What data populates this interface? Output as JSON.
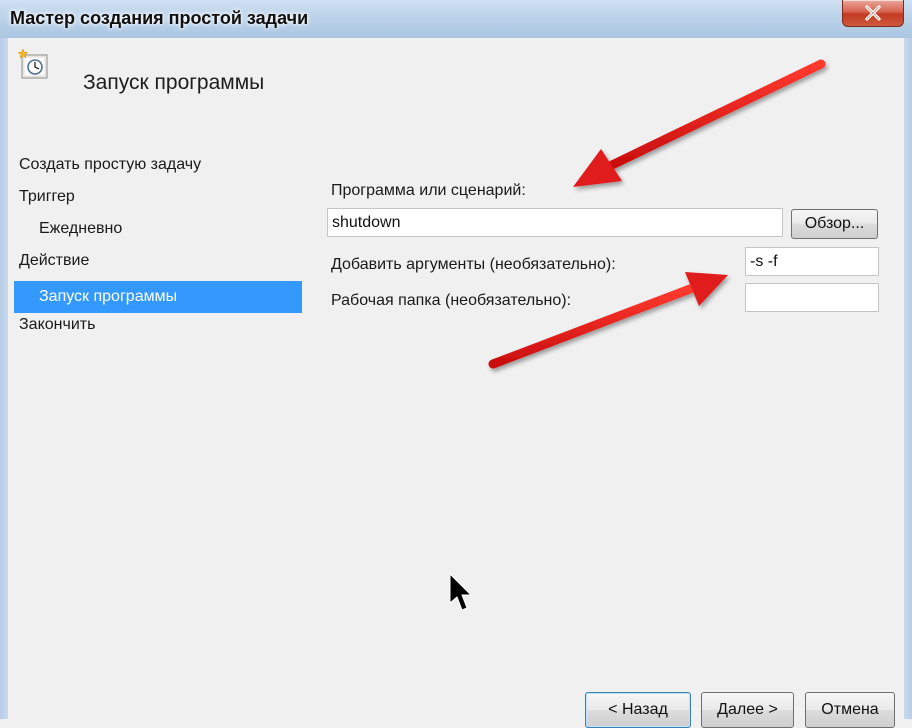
{
  "window": {
    "title": "Мастер создания простой задачи",
    "close_icon": "close-icon"
  },
  "header": {
    "icon": "scheduled-task-clock-icon",
    "page_title": "Запуск программы"
  },
  "nav": {
    "items": [
      {
        "label": "Создать простую задачу",
        "sub": false,
        "active": false
      },
      {
        "label": "Триггер",
        "sub": false,
        "active": false
      },
      {
        "label": "Ежедневно",
        "sub": true,
        "active": false
      },
      {
        "label": "Действие",
        "sub": false,
        "active": false
      },
      {
        "label": "Запуск программы",
        "sub": true,
        "active": true
      },
      {
        "label": "Закончить",
        "sub": false,
        "active": false
      }
    ]
  },
  "form": {
    "program_label": "Программа или сценарий:",
    "program_value": "shutdown",
    "browse_label": "Обзор...",
    "args_label": "Добавить аргументы (необязательно):",
    "args_value": "-s -f",
    "workdir_label": "Рабочая папка (необязательно):",
    "workdir_value": ""
  },
  "footer": {
    "back_label": "< Назад",
    "next_label": "Далее >",
    "cancel_label": "Отмена"
  },
  "annotations": {
    "arrow_color": "#e01a1a",
    "cursor_icon": "mouse-pointer-icon"
  }
}
